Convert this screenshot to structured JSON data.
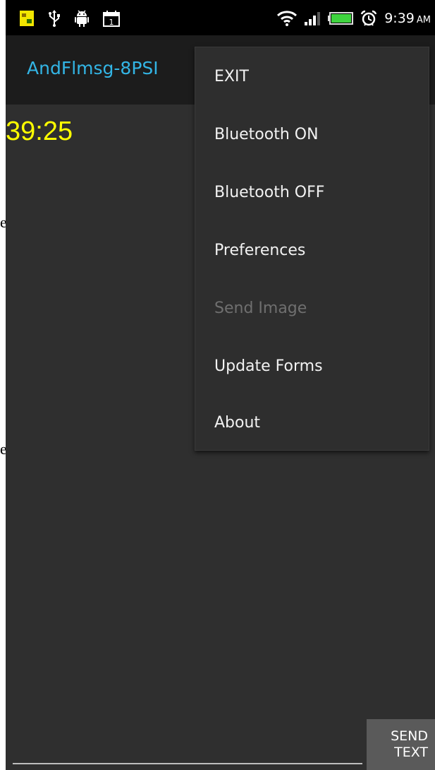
{
  "status_bar": {
    "time": "9:39",
    "ampm": "AM",
    "icons": [
      "notification-app-icon",
      "usb-icon",
      "android-debug-icon",
      "calendar-icon",
      "wifi-icon",
      "signal-icon",
      "battery-icon",
      "alarm-icon"
    ],
    "calendar_day": "1"
  },
  "app": {
    "title": "AndFlmsg-8PSI",
    "timer": "39:25",
    "left_glyph_top": "e",
    "left_glyph_bottom": "e",
    "send_button": {
      "line1": "SEND",
      "line2": "TEXT"
    }
  },
  "menu": {
    "items": [
      {
        "label": "EXIT",
        "enabled": true
      },
      {
        "label": "Bluetooth ON",
        "enabled": true
      },
      {
        "label": "Bluetooth OFF",
        "enabled": true
      },
      {
        "label": "Preferences",
        "enabled": true
      },
      {
        "label": "Send Image",
        "enabled": false
      },
      {
        "label": "Update Forms",
        "enabled": true
      },
      {
        "label": "About",
        "enabled": true
      }
    ]
  },
  "colors": {
    "title": "#33b5e5",
    "timer": "#ffff00",
    "menu_text": "#f2f2f2",
    "menu_disabled": "#6f6f6f"
  }
}
